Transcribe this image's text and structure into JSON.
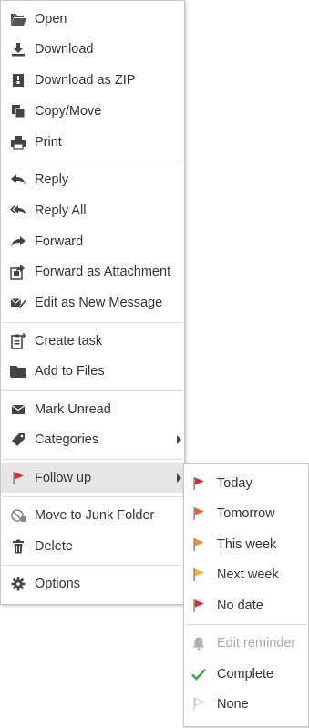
{
  "main_menu": {
    "groups": [
      {
        "items": [
          {
            "label": "Open",
            "icon": "folder-open-icon"
          },
          {
            "label": "Download",
            "icon": "download-icon"
          },
          {
            "label": "Download as ZIP",
            "icon": "zip-file-icon"
          },
          {
            "label": "Copy/Move",
            "icon": "copy-icon"
          },
          {
            "label": "Print",
            "icon": "printer-icon"
          }
        ]
      },
      {
        "items": [
          {
            "label": "Reply",
            "icon": "reply-icon"
          },
          {
            "label": "Reply All",
            "icon": "reply-all-icon"
          },
          {
            "label": "Forward",
            "icon": "forward-icon"
          },
          {
            "label": "Forward as Attachment",
            "icon": "forward-attachment-icon"
          },
          {
            "label": "Edit as New Message",
            "icon": "edit-message-icon"
          }
        ]
      },
      {
        "items": [
          {
            "label": "Create task",
            "icon": "create-task-icon"
          },
          {
            "label": "Add to Files",
            "icon": "folder-icon"
          }
        ]
      },
      {
        "items": [
          {
            "label": "Mark Unread",
            "icon": "envelope-icon"
          },
          {
            "label": "Categories",
            "icon": "tag-icon",
            "has_submenu": true
          }
        ]
      },
      {
        "items": [
          {
            "label": "Follow up",
            "icon": "flag-icon",
            "has_submenu": true,
            "active": true
          }
        ]
      },
      {
        "items": [
          {
            "label": "Move to Junk Folder",
            "icon": "junk-icon"
          },
          {
            "label": "Delete",
            "icon": "trash-icon"
          }
        ]
      },
      {
        "items": [
          {
            "label": "Options",
            "icon": "gear-icon"
          }
        ]
      }
    ]
  },
  "follow_up_submenu": {
    "groups": [
      {
        "items": [
          {
            "label": "Today",
            "icon": "flag-icon",
            "color": "#d32f2f"
          },
          {
            "label": "Tomorrow",
            "icon": "flag-icon",
            "color": "#e8642c"
          },
          {
            "label": "This week",
            "icon": "flag-icon",
            "color": "#f08c2a"
          },
          {
            "label": "Next week",
            "icon": "flag-icon",
            "color": "#f5b323"
          },
          {
            "label": "No date",
            "icon": "flag-icon",
            "color": "#d32f2f"
          }
        ]
      },
      {
        "items": [
          {
            "label": "Edit reminder",
            "icon": "bell-icon",
            "disabled": true
          },
          {
            "label": "Complete",
            "icon": "checkmark-icon",
            "color": "#3cab47"
          },
          {
            "label": "None",
            "icon": "flag-outline-icon"
          }
        ]
      }
    ]
  }
}
